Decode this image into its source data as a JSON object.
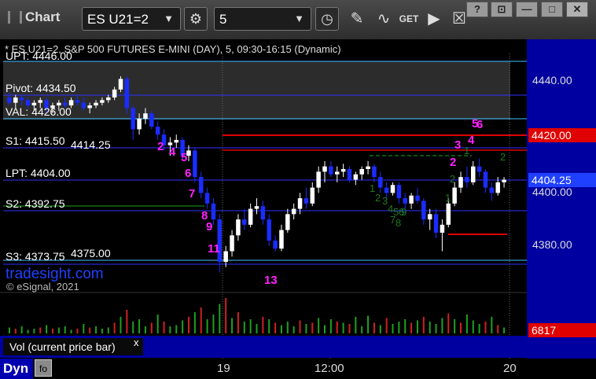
{
  "toolbar": {
    "title": "Chart",
    "symbol": "ES U21=2",
    "interval": "5",
    "icons": [
      "settings-gear-icon",
      "clock-icon",
      "pencil-icon",
      "study-icon",
      "get-icon",
      "play-icon",
      "checkbox-icon"
    ],
    "window_buttons": [
      "?",
      "⊡",
      "—",
      "□",
      "✕"
    ]
  },
  "chart_header": "* ES U21=2, S&P 500 FUTURES E-MINI (DAY), 5, 09:30-16:15 (Dynamic)",
  "levels": {
    "upt": "UPT: 4446.00",
    "pivot": "Pivot: 4434.50",
    "val": "VAL: 4426.00",
    "s1": "S1: 4415.50",
    "s1_extra": "4414.25",
    "lpt": "LPT: 4404.00",
    "s2": "S2: 4392.75",
    "s3": "S3: 4373.75",
    "s3_extra": "4375.00"
  },
  "price_axis": [
    "4440.00",
    "4400.00",
    "4380.00"
  ],
  "price_tags": {
    "red": "4420.00",
    "blue": "4404.25",
    "volume": "6817"
  },
  "watermark": "tradesight.com",
  "copyright": "© eSignal, 2021",
  "volume_label": "Vol (current price bar)",
  "volume_close": "x",
  "time_axis": [
    "19",
    "12:00",
    "20"
  ],
  "bottom": {
    "mode": "Dyn"
  },
  "td_counts_magenta": [
    "2",
    "4",
    "5",
    "6",
    "7",
    "8",
    "9",
    "11",
    "13",
    "2",
    "3",
    "4",
    "5",
    "6"
  ],
  "td_counts_green": [
    "1",
    "2",
    "3",
    "4",
    "5",
    "6",
    "7",
    "8",
    "9",
    "1",
    "2",
    "1",
    "2"
  ],
  "colors": {
    "up_candle": "#ffffff",
    "down_candle": "#1a2cff",
    "level_line": "#3a3aff",
    "resistance_red": "#e00000",
    "magenta": "#ff22ff",
    "green_count": "#1e7a1e",
    "volume_panel": "#0000a0"
  },
  "chart_data": {
    "type": "candlestick",
    "ylim": [
      4366,
      4452
    ],
    "candles": [
      [
        4436,
        4438,
        4433,
        4434
      ],
      [
        4434,
        4437,
        4432,
        4436
      ],
      [
        4436,
        4437,
        4433,
        4435
      ],
      [
        4435,
        4436,
        4432,
        4433
      ],
      [
        4433,
        4435,
        4431,
        4434
      ],
      [
        4434,
        4436,
        4432,
        4435
      ],
      [
        4435,
        4436,
        4430,
        4432
      ],
      [
        4432,
        4434,
        4430,
        4433
      ],
      [
        4433,
        4435,
        4431,
        4434
      ],
      [
        4434,
        4436,
        4432,
        4433
      ],
      [
        4433,
        4436,
        4432,
        4435
      ],
      [
        4435,
        4437,
        4433,
        4434
      ],
      [
        4434,
        4436,
        4431,
        4432
      ],
      [
        4432,
        4434,
        4430,
        4433
      ],
      [
        4433,
        4435,
        4432,
        4434
      ],
      [
        4434,
        4436,
        4433,
        4435
      ],
      [
        4435,
        4437,
        4434,
        4436
      ],
      [
        4436,
        4440,
        4435,
        4439
      ],
      [
        4439,
        4444,
        4438,
        4443
      ],
      [
        4443,
        4444,
        4430,
        4432
      ],
      [
        4432,
        4433,
        4420,
        4424
      ],
      [
        4424,
        4430,
        4422,
        4428
      ],
      [
        4428,
        4432,
        4426,
        4430
      ],
      [
        4430,
        4431,
        4424,
        4425
      ],
      [
        4425,
        4427,
        4420,
        4422
      ],
      [
        4422,
        4424,
        4416,
        4418
      ],
      [
        4418,
        4421,
        4414,
        4419
      ],
      [
        4419,
        4422,
        4417,
        4420
      ],
      [
        4420,
        4421,
        4412,
        4414
      ],
      [
        4414,
        4418,
        4412,
        4416
      ],
      [
        4416,
        4417,
        4404,
        4406
      ],
      [
        4406,
        4408,
        4398,
        4400
      ],
      [
        4400,
        4402,
        4394,
        4396
      ],
      [
        4396,
        4398,
        4388,
        4390
      ],
      [
        4390,
        4392,
        4370,
        4374
      ],
      [
        4374,
        4380,
        4372,
        4378
      ],
      [
        4378,
        4386,
        4376,
        4384
      ],
      [
        4384,
        4392,
        4382,
        4390
      ],
      [
        4390,
        4394,
        4386,
        4388
      ],
      [
        4388,
        4396,
        4387,
        4394
      ],
      [
        4394,
        4398,
        4392,
        4395
      ],
      [
        4395,
        4397,
        4388,
        4390
      ],
      [
        4390,
        4392,
        4380,
        4382
      ],
      [
        4382,
        4384,
        4378,
        4379
      ],
      [
        4379,
        4388,
        4378,
        4386
      ],
      [
        4386,
        4394,
        4385,
        4392
      ],
      [
        4392,
        4396,
        4390,
        4394
      ],
      [
        4394,
        4400,
        4392,
        4398
      ],
      [
        4398,
        4402,
        4394,
        4396
      ],
      [
        4396,
        4404,
        4395,
        4402
      ],
      [
        4402,
        4410,
        4400,
        4408
      ],
      [
        4408,
        4412,
        4404,
        4410
      ],
      [
        4410,
        4412,
        4406,
        4407
      ],
      [
        4407,
        4410,
        4404,
        4408
      ],
      [
        4408,
        4411,
        4406,
        4409
      ],
      [
        4409,
        4410,
        4404,
        4405
      ],
      [
        4405,
        4408,
        4403,
        4407
      ],
      [
        4407,
        4410,
        4405,
        4409
      ],
      [
        4409,
        4412,
        4407,
        4410
      ],
      [
        4410,
        4411,
        4404,
        4406
      ],
      [
        4406,
        4408,
        4400,
        4402
      ],
      [
        4402,
        4404,
        4398,
        4400
      ],
      [
        4400,
        4404,
        4399,
        4403
      ],
      [
        4403,
        4404,
        4396,
        4398
      ],
      [
        4398,
        4400,
        4394,
        4396
      ],
      [
        4396,
        4400,
        4394,
        4399
      ],
      [
        4399,
        4402,
        4396,
        4397
      ],
      [
        4397,
        4398,
        4388,
        4390
      ],
      [
        4390,
        4394,
        4386,
        4392
      ],
      [
        4392,
        4394,
        4383,
        4385
      ],
      [
        4385,
        4390,
        4378,
        4388
      ],
      [
        4388,
        4398,
        4387,
        4396
      ],
      [
        4396,
        4404,
        4395,
        4402
      ],
      [
        4402,
        4408,
        4400,
        4406
      ],
      [
        4406,
        4410,
        4402,
        4404
      ],
      [
        4404,
        4412,
        4403,
        4410
      ],
      [
        4410,
        4413,
        4406,
        4408
      ],
      [
        4408,
        4409,
        4400,
        4402
      ],
      [
        4402,
        4404,
        4397,
        4400
      ],
      [
        4400,
        4406,
        4399,
        4404
      ],
      [
        4404,
        4406,
        4402,
        4405
      ]
    ]
  }
}
